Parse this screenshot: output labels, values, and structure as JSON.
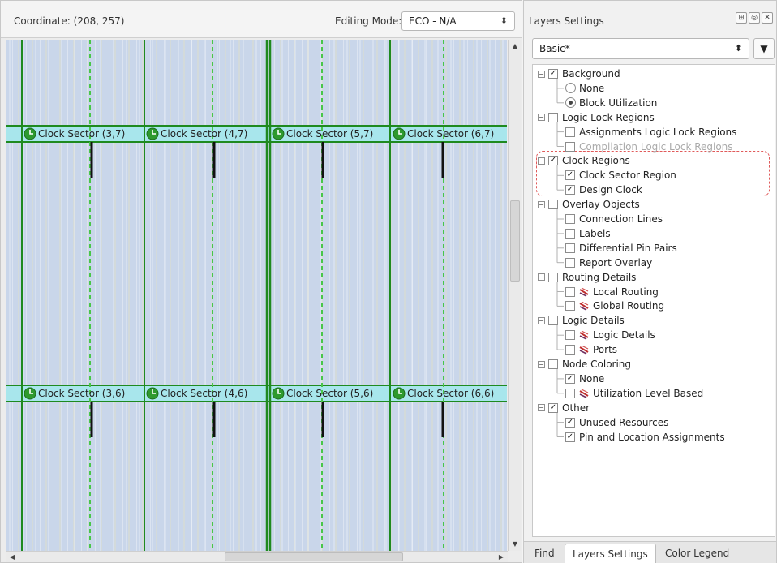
{
  "toolbar": {
    "coordinate": "Coordinate: (208, 257)",
    "editing_mode_label": "Editing Mode:",
    "editing_mode_value": "ECO - N/A"
  },
  "map": {
    "sectors_top": [
      "Clock Sector (3,7)",
      "Clock Sector (4,7)",
      "Clock Sector (5,7)",
      "Clock Sector (6,7)"
    ],
    "sectors_bottom": [
      "Clock Sector (3,6)",
      "Clock Sector (4,6)",
      "Clock Sector (5,6)",
      "Clock Sector (6,6)"
    ],
    "colors": {
      "sector_band": "#a8e6ec",
      "sector_line": "#1f8a1f",
      "dashed_line": "#48c648",
      "background": "#c9d6ea"
    }
  },
  "panel": {
    "title": "Layers Settings",
    "preset": "Basic*",
    "tree": [
      {
        "label": "Background",
        "level": 0,
        "control": "checkbox",
        "checked": true,
        "expander": "−"
      },
      {
        "label": "None",
        "level": 1,
        "control": "radio",
        "checked": false
      },
      {
        "label": "Block Utilization",
        "level": 1,
        "control": "radio",
        "checked": true
      },
      {
        "label": "Logic Lock Regions",
        "level": 0,
        "control": "checkbox",
        "checked": false,
        "expander": "−"
      },
      {
        "label": "Assignments Logic Lock Regions",
        "level": 1,
        "control": "checkbox",
        "checked": false
      },
      {
        "label": "Compilation Logic Lock Regions",
        "level": 1,
        "control": "checkbox",
        "checked": false,
        "disabled": true
      },
      {
        "label": "Clock Regions",
        "level": 0,
        "control": "checkbox",
        "checked": true,
        "expander": "−"
      },
      {
        "label": "Clock Sector Region",
        "level": 1,
        "control": "checkbox",
        "checked": true
      },
      {
        "label": "Design Clock",
        "level": 1,
        "control": "checkbox",
        "checked": true
      },
      {
        "label": "Overlay Objects",
        "level": 0,
        "control": "checkbox",
        "checked": false,
        "expander": "−"
      },
      {
        "label": "Connection Lines",
        "level": 1,
        "control": "checkbox",
        "checked": false
      },
      {
        "label": "Labels",
        "level": 1,
        "control": "checkbox",
        "checked": false
      },
      {
        "label": "Differential Pin Pairs",
        "level": 1,
        "control": "checkbox",
        "checked": false
      },
      {
        "label": "Report Overlay",
        "level": 1,
        "control": "checkbox",
        "checked": false
      },
      {
        "label": "Routing Details",
        "level": 0,
        "control": "checkbox",
        "checked": false,
        "expander": "−"
      },
      {
        "label": "Local Routing",
        "level": 1,
        "control": "checkbox",
        "checked": false,
        "icon": "routing-icon"
      },
      {
        "label": "Global Routing",
        "level": 1,
        "control": "checkbox",
        "checked": false,
        "icon": "routing-icon"
      },
      {
        "label": "Logic Details",
        "level": 0,
        "control": "checkbox",
        "checked": false,
        "expander": "−"
      },
      {
        "label": "Logic Details",
        "level": 1,
        "control": "checkbox",
        "checked": false,
        "icon": "routing-icon"
      },
      {
        "label": "Ports",
        "level": 1,
        "control": "checkbox",
        "checked": false,
        "icon": "routing-icon"
      },
      {
        "label": "Node Coloring",
        "level": 0,
        "control": "checkbox",
        "checked": false,
        "expander": "−"
      },
      {
        "label": "None",
        "level": 1,
        "control": "checkbox",
        "checked": true
      },
      {
        "label": "Utilization Level Based",
        "level": 1,
        "control": "checkbox",
        "checked": false,
        "icon": "routing-icon"
      },
      {
        "label": "Other",
        "level": 0,
        "control": "checkbox",
        "checked": true,
        "expander": "−"
      },
      {
        "label": "Unused Resources",
        "level": 1,
        "control": "checkbox",
        "checked": true
      },
      {
        "label": "Pin and Location Assignments",
        "level": 1,
        "control": "checkbox",
        "checked": true
      }
    ],
    "tabs": [
      {
        "label": "Find",
        "active": false
      },
      {
        "label": "Layers Settings",
        "active": true
      },
      {
        "label": "Color Legend",
        "active": false
      }
    ]
  }
}
